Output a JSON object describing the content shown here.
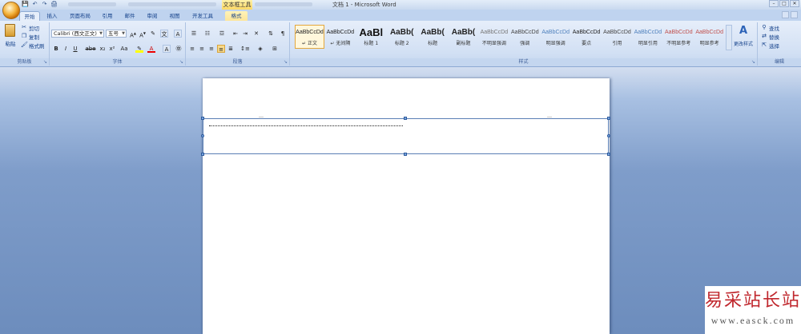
{
  "window": {
    "title": "文档 1 - Microsoft Word",
    "context_tab_title": "文本框工具",
    "buttons": [
      "–",
      "□",
      "✕"
    ]
  },
  "quick_access": [
    "💾",
    "↶",
    "↷",
    "🖨"
  ],
  "tabs": [
    {
      "label": "开始",
      "active": true
    },
    {
      "label": "插入"
    },
    {
      "label": "页面布局"
    },
    {
      "label": "引用"
    },
    {
      "label": "邮件"
    },
    {
      "label": "审阅"
    },
    {
      "label": "视图"
    },
    {
      "label": "开发工具"
    },
    {
      "label": "格式",
      "contextual": true
    }
  ],
  "clipboard": {
    "paste": "粘贴",
    "cut": "剪切",
    "copy": "复制",
    "format_painter": "格式刷",
    "group_label": "剪贴板"
  },
  "font": {
    "name": "Calibri (西文正文)",
    "size": "五号",
    "group_label": "字体",
    "buttons": [
      "B",
      "I",
      "U",
      "abe",
      "x₂",
      "x²",
      "Aa",
      "A",
      "A"
    ]
  },
  "paragraph": {
    "group_label": "段落"
  },
  "styles": {
    "group_label": "样式",
    "change_styles": "更改样式",
    "items": [
      {
        "sample": "AaBbCcDd",
        "name": "↵ 正文",
        "selected": true,
        "color": "#222222"
      },
      {
        "sample": "AaBbCcDd",
        "name": "↵ 无间隔",
        "color": "#222222"
      },
      {
        "sample": "AaBl",
        "name": "标题 1",
        "color": "#111111"
      },
      {
        "sample": "AaBb(",
        "name": "标题 2",
        "color": "#222222"
      },
      {
        "sample": "AaBb(",
        "name": "标题",
        "color": "#222222"
      },
      {
        "sample": "AaBb(",
        "name": "副标题",
        "color": "#222222"
      },
      {
        "sample": "AaBbCcDd",
        "name": "不明显强调",
        "color": "#777777"
      },
      {
        "sample": "AaBbCcDd",
        "name": "强调",
        "color": "#444444"
      },
      {
        "sample": "AaBbCcDd",
        "name": "明显强调",
        "color": "#4f81bd"
      },
      {
        "sample": "AaBbCcDd",
        "name": "要点",
        "color": "#222222"
      },
      {
        "sample": "AaBbCcDd",
        "name": "引用",
        "color": "#444444"
      },
      {
        "sample": "AaBbCcDd",
        "name": "明显引用",
        "color": "#4f81bd"
      },
      {
        "sample": "AaBbCcDd",
        "name": "不明显参考",
        "color": "#c0504d"
      },
      {
        "sample": "AaBbCcDd",
        "name": "明显参考",
        "color": "#c0504d"
      }
    ]
  },
  "editing": {
    "find": "查找",
    "replace": "替换",
    "select": "选择",
    "group_label": "编辑"
  },
  "watermark": {
    "cn": "易采站长站",
    "en": "www.easck.com"
  }
}
